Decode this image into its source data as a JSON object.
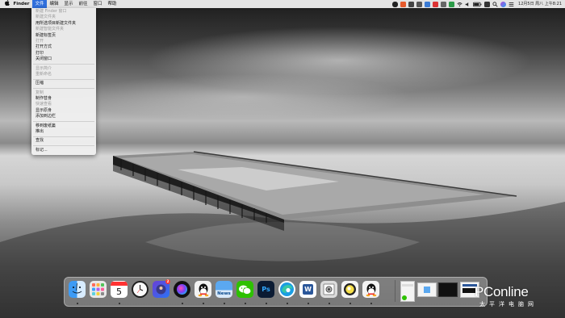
{
  "menubar": {
    "apple_icon": "apple-logo",
    "items": [
      {
        "label": "Finder"
      },
      {
        "label": "文件"
      },
      {
        "label": "编辑"
      },
      {
        "label": "显示"
      },
      {
        "label": "前往"
      },
      {
        "label": "窗口"
      },
      {
        "label": "帮助"
      }
    ],
    "active_item": "文件",
    "status_icons": [
      "penguin-icon",
      "app-icon",
      "app-icon",
      "app-icon",
      "app-icon",
      "wifi-icon",
      "volume-icon",
      "battery-icon",
      "language-icon",
      "spotlight-icon",
      "siri-icon",
      "menu-icon"
    ],
    "clock": "12月5日 周八 上午8:21"
  },
  "file_menu": {
    "items": [
      {
        "label": "新建 Finder 窗口",
        "enabled": false
      },
      {
        "label": "新建文件夹",
        "enabled": false
      },
      {
        "label": "用所选项目新建文件夹",
        "enabled": true
      },
      {
        "label": "新建智能文件夹",
        "enabled": false
      },
      {
        "label": "新建标签页",
        "enabled": true
      },
      {
        "label": "打开",
        "enabled": false
      },
      {
        "label": "打开方式",
        "enabled": true
      },
      {
        "label": "打印",
        "enabled": true
      },
      {
        "label": "关闭窗口",
        "enabled": true
      },
      {
        "sep": true
      },
      {
        "label": "显示简介",
        "enabled": false
      },
      {
        "label": "重新命名",
        "enabled": false
      },
      {
        "sep": true
      },
      {
        "label": "压缩",
        "enabled": true
      },
      {
        "sep": true
      },
      {
        "label": "复制",
        "enabled": false
      },
      {
        "label": "制作替身",
        "enabled": true
      },
      {
        "label": "快速查看",
        "enabled": false
      },
      {
        "label": "显示原身",
        "enabled": true
      },
      {
        "label": "添加到边栏",
        "enabled": true
      },
      {
        "sep": true
      },
      {
        "label": "移到废纸篓",
        "enabled": true
      },
      {
        "label": "推出",
        "enabled": true
      },
      {
        "sep": true
      },
      {
        "label": "查找",
        "enabled": true
      },
      {
        "sep": true
      },
      {
        "label": "标记...",
        "enabled": true
      }
    ]
  },
  "dock": {
    "apps": [
      {
        "icon": "finder-icon",
        "text": ""
      },
      {
        "icon": "launchpad-icon",
        "text": ""
      },
      {
        "icon": "calendar-icon",
        "text": "5"
      },
      {
        "icon": "clock-icon",
        "text": ""
      },
      {
        "icon": "app-store-icon",
        "text": ""
      },
      {
        "icon": "siri-icon",
        "text": ""
      },
      {
        "icon": "qq-icon",
        "text": ""
      },
      {
        "icon": "news-icon",
        "text": "News"
      },
      {
        "icon": "wechat-icon",
        "text": ""
      },
      {
        "icon": "photoshop-icon",
        "text": "Ps"
      },
      {
        "icon": "edge-icon",
        "text": ""
      },
      {
        "icon": "word-icon",
        "text": "W"
      },
      {
        "icon": "preview-icon",
        "text": ""
      },
      {
        "icon": "sketch-icon",
        "text": ""
      },
      {
        "icon": "qq-icon",
        "text": ""
      }
    ],
    "app_badge": "2"
  },
  "watermark": {
    "logo": "PConline",
    "subtitle": "太平洋电脑网"
  },
  "colors": {
    "accent": "#2f6fdc",
    "menubar": "#ececec",
    "badge": "#ff3b30"
  }
}
